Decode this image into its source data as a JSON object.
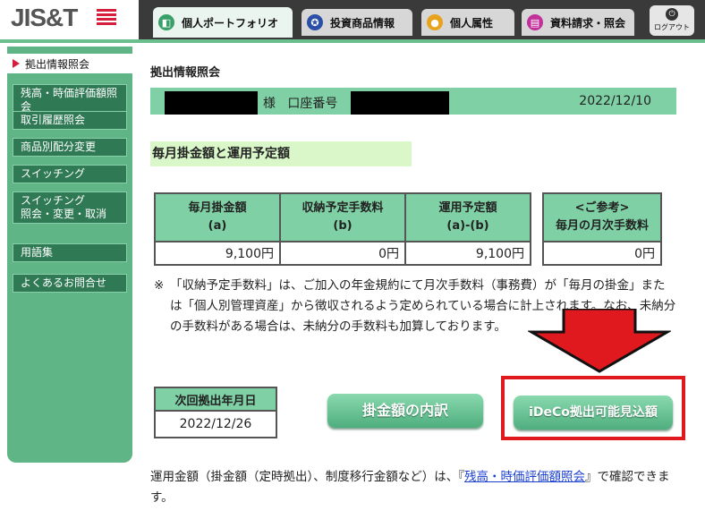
{
  "header": {
    "logo_text": "JIS&T",
    "tabs": [
      {
        "label": "個人ポートフォリオ",
        "icon": "portfolio-icon",
        "active": true
      },
      {
        "label": "投資商品情報",
        "icon": "investment-icon",
        "active": false
      },
      {
        "label": "個人属性",
        "icon": "person-icon",
        "active": false
      },
      {
        "label": "資料請求・照会",
        "icon": "document-icon",
        "active": false
      }
    ],
    "logout_label": "ログアウト"
  },
  "sidebar": {
    "active_label": "拠出情報照会",
    "items": [
      {
        "label": "残高・時価評価額照会"
      },
      {
        "label": "取引履歴照会"
      },
      {
        "label": "商品別配分変更"
      },
      {
        "label": "スイッチング"
      },
      {
        "label_line1": "スイッチング",
        "label_line2": "照会・変更・取消"
      },
      {
        "label": "用語集"
      },
      {
        "label": "よくあるお問合せ"
      }
    ]
  },
  "main": {
    "page_title": "拠出情報照会",
    "account": {
      "honorific": "様",
      "account_label": "口座番号",
      "date": "2022/12/10"
    },
    "section_title": "毎月掛金額と運用予定額",
    "fee_table": {
      "headers": [
        {
          "line1": "毎月掛金額",
          "line2": "(a)"
        },
        {
          "line1": "収納予定手数料",
          "line2": "(b)"
        },
        {
          "line1": "運用予定額",
          "line2": "(a)-(b)"
        }
      ],
      "values": [
        "9,100円",
        "0円",
        "9,100円"
      ]
    },
    "ref_table": {
      "line1": "<ご参考>",
      "line2": "毎月の月次手数料",
      "value": "0円"
    },
    "note_mark": "※",
    "note_text": "「収納予定手数料」は、ご加入の年金規約にて月次手数料（事務費）が「毎月の掛金」または「個人別管理資産」から徴収されるよう定められている場合に計上されます。なお、未納分の手数料がある場合は、未納分の手数料も加算しております。",
    "next_contribution": {
      "header": "次回拠出年月日",
      "date": "2022/12/26"
    },
    "buttons": {
      "breakdown": "掛金額の内訳",
      "ideco": "iDeCo拠出可能見込額"
    },
    "bottom_text_before": "運用金額（掛金額（定時拠出）、制度移行金額など）は、『",
    "bottom_link": "残高・時価評価額照会",
    "bottom_text_after": "』で確認できます。"
  },
  "colors": {
    "accent_green": "#7fd1a5",
    "sidebar_green": "#2f7a55",
    "highlight_red": "#e0191f"
  }
}
